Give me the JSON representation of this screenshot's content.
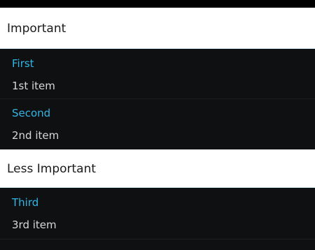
{
  "sections": [
    {
      "header": "Important",
      "items": [
        {
          "title": "First",
          "subtitle": "1st item"
        },
        {
          "title": "Second",
          "subtitle": "2nd item"
        }
      ]
    },
    {
      "header": "Less Important",
      "items": [
        {
          "title": "Third",
          "subtitle": "3rd item"
        }
      ]
    }
  ],
  "colors": {
    "accent": "#33b5e5",
    "header_background": "#ffffff",
    "list_background": "#0f1012",
    "subtitle_text": "#d8d8d8"
  }
}
